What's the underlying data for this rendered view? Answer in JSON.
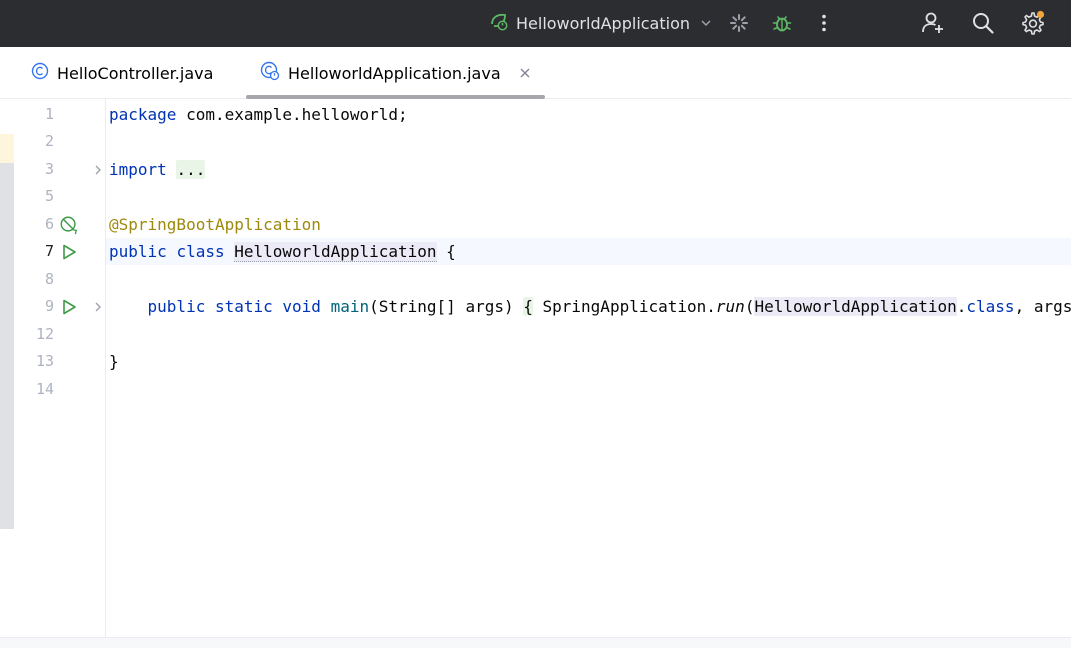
{
  "topbar": {
    "run_config_label": "HelloworldApplication",
    "colors": {
      "background": "#2b2d30",
      "accent_green": "#5fb865",
      "notification_dot": "#f2a33a"
    }
  },
  "tabs": [
    {
      "label": "HelloController.java",
      "icon": "class-icon",
      "active": false
    },
    {
      "label": "HelloworldApplication.java",
      "icon": "spring-app-class-icon",
      "active": true
    }
  ],
  "gutter": {
    "line_numbers": [
      "1",
      "2",
      "3",
      "5",
      "6",
      "7",
      "8",
      "9",
      "12",
      "13",
      "14"
    ],
    "active_line": "7"
  },
  "code": {
    "l1": {
      "kw": "package",
      "rest": " com.example.helloworld;"
    },
    "l3": {
      "kw": "import",
      "folded": "..."
    },
    "l6": {
      "annotation": "@SpringBootApplication"
    },
    "l7": {
      "kw1": "public",
      "kw2": "class",
      "name": "HelloworldApplication",
      "brace": " {"
    },
    "l9": {
      "kw1": "public",
      "kw2": "static",
      "kw3": "void",
      "method": "main",
      "params": "(String[] args) ",
      "fold_open": "{",
      "call_pre": " SpringApplication.",
      "call_method": "run",
      "paren": "(",
      "cls": "HelloworldApplication",
      "dot": ".",
      "kw_class": "class",
      "tail": ", args); }"
    },
    "l13": {
      "brace": "}"
    }
  }
}
